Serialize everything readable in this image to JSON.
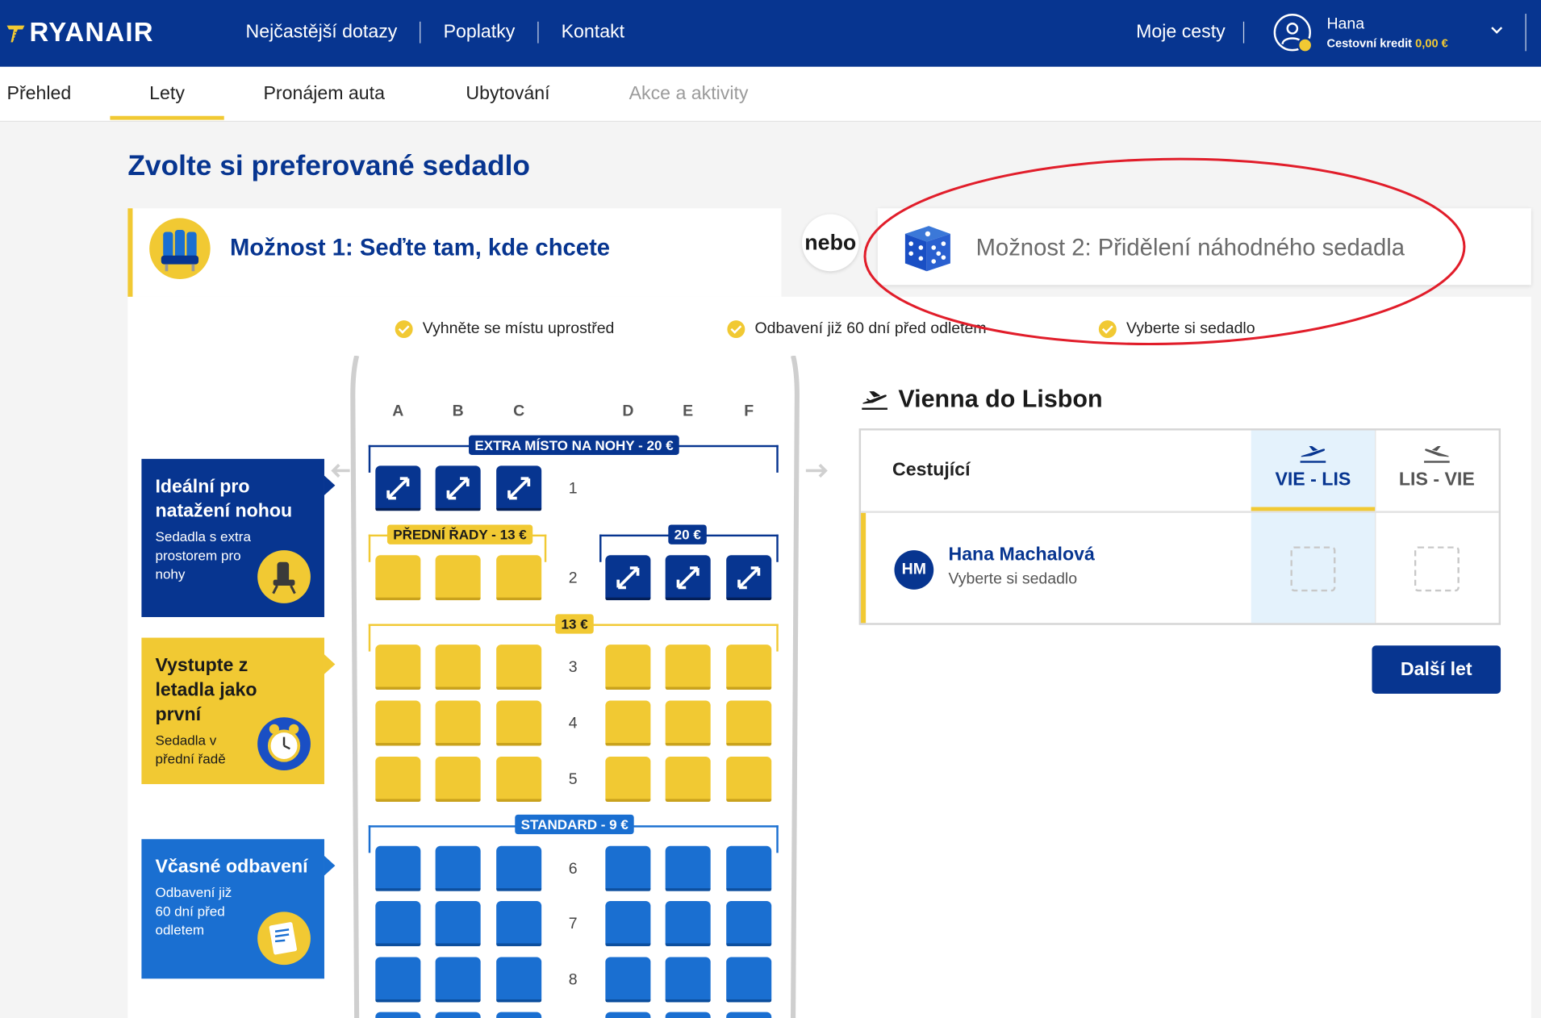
{
  "header": {
    "logo": "RYANAIR",
    "nav": [
      "Nejčastější dotazy",
      "Poplatky",
      "Kontakt"
    ],
    "my_trips": "Moje cesty",
    "user_name": "Hana",
    "credit_label": "Cestovní kredit",
    "credit_amount": "0,00 €"
  },
  "subnav": {
    "tabs": [
      {
        "label": "Přehled"
      },
      {
        "label": "Lety",
        "active": true
      },
      {
        "label": "Pronájem auta"
      },
      {
        "label": "Ubytování"
      },
      {
        "label": "Akce a aktivity",
        "disabled": true
      }
    ]
  },
  "page_title": "Zvolte si preferované sedadlo",
  "option1": {
    "title": "Možnost 1: Seďte tam, kde chcete"
  },
  "separator": "nebo",
  "option2": {
    "title": "Možnost 2: Přidělení náhodného sedadla"
  },
  "benefits": [
    "Vyhněte se místu uprostřed",
    "Odbavení již 60 dní před odletem",
    "Vyberte si sedadlo"
  ],
  "seatmap": {
    "columns": [
      "A",
      "B",
      "C",
      "D",
      "E",
      "F"
    ],
    "zones": {
      "extra": "EXTRA MÍSTO NA NOHY - 20 €",
      "front": "PŘEDNÍ ŘADY - 13 €",
      "extra_right": "20 €",
      "middle": "13 €",
      "standard": "STANDARD - 9 €"
    },
    "rows": [
      "1",
      "2",
      "3",
      "4",
      "5",
      "6",
      "7",
      "8"
    ]
  },
  "promos": [
    {
      "title": "Ideální pro natažení nohou",
      "desc": "Sedadla s extra prostorem pro nohy"
    },
    {
      "title": "Vystupte z letadla jako první",
      "desc": "Sedadla v přední řadě"
    },
    {
      "title": "Včasné odbavení",
      "desc": "Odbavení již 60 dní před odletem"
    }
  ],
  "route": {
    "title": "Vienna do Lisbon",
    "header_label": "Cestující",
    "legs": [
      "VIE - LIS",
      "LIS - VIE"
    ],
    "passenger": {
      "initials": "HM",
      "name": "Hana Machalová",
      "hint": "Vyberte si sedadlo"
    },
    "next_button": "Další let"
  },
  "colors": {
    "brand": "#073590",
    "accent": "#f1c933",
    "standard": "#1a6fd1",
    "highlight": "#e4f2fc",
    "annotation": "#e11d2a"
  }
}
